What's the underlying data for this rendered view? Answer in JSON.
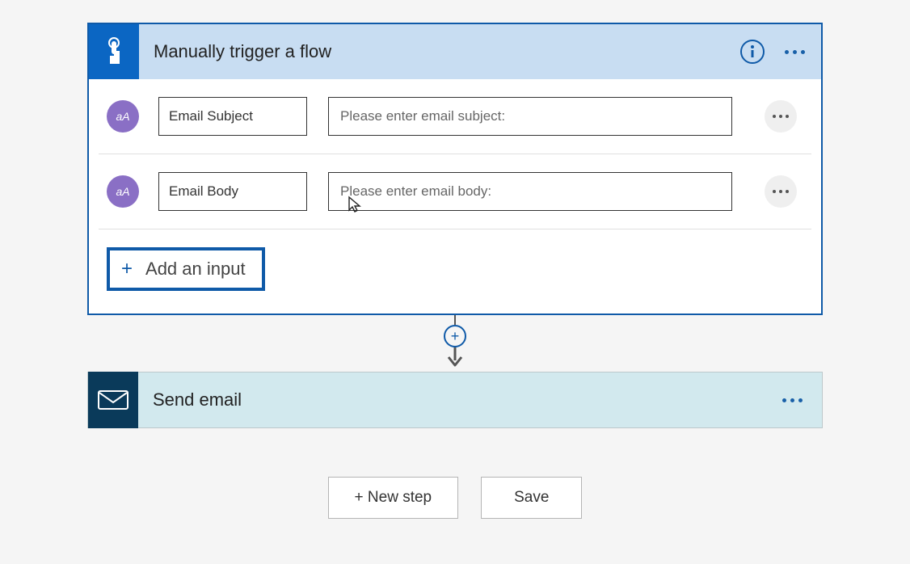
{
  "trigger": {
    "title": "Manually trigger a flow",
    "icon_name": "pointer-tap-icon",
    "inputs": [
      {
        "name_value": "Email Subject",
        "prompt_placeholder": "Please enter email subject:",
        "badge": "aA"
      },
      {
        "name_value": "Email Body",
        "prompt_placeholder": "Please enter email body:",
        "badge": "aA"
      }
    ],
    "add_input_label": "Add an input"
  },
  "action": {
    "title": "Send email",
    "icon_name": "envelope-icon"
  },
  "footer": {
    "new_step_label": "+ New step",
    "save_label": "Save"
  }
}
